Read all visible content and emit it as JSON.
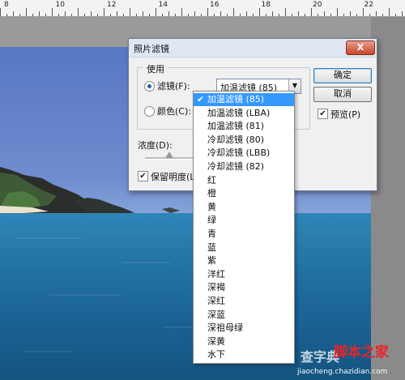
{
  "ruler": {
    "numbers": [
      "8",
      "10",
      "12",
      "14",
      "16",
      "18",
      "20",
      "22"
    ]
  },
  "dialog": {
    "title": "照片滤镜",
    "close_label": "X",
    "group_label": "使用",
    "filter_radio_label": "滤镜(F):",
    "filter_selected": "加温滤镜 (85)",
    "color_radio_label": "颜色(C):",
    "ok_label": "确定",
    "cancel_label": "取消",
    "preview_label": "预览(P)",
    "density_label": "浓度(D):",
    "preserve_label": "保留明度(L)"
  },
  "dropdown": {
    "options": [
      "加温滤镜 (85)",
      "加温滤镜 (LBA)",
      "加温滤镜 (81)",
      "冷却滤镜 (80)",
      "冷却滤镜 (LBB)",
      "冷却滤镜 (82)",
      "红",
      "橙",
      "黄",
      "绿",
      "青",
      "蓝",
      "紫",
      "洋红",
      "深褐",
      "深红",
      "深蓝",
      "深祖母绿",
      "深黄",
      "水下"
    ],
    "selected_index": 0,
    "check_mark": "✔"
  },
  "watermark": {
    "main": "查字典",
    "brand": "脚本之家",
    "url": "jiaocheng.chazidian.com"
  },
  "colors": {
    "accent": "#3399ff",
    "sky": "#5777c2",
    "sea": "#1b6497"
  }
}
